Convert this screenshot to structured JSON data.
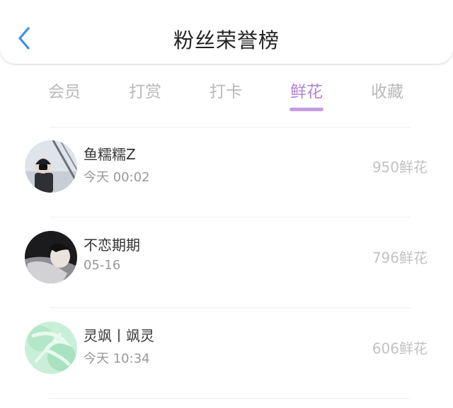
{
  "header": {
    "title": "粉丝荣誉榜",
    "back_icon": "chevron-left-icon"
  },
  "accent_color": "#b482d6",
  "tabs": [
    {
      "label": "会员",
      "active": false
    },
    {
      "label": "打赏",
      "active": false
    },
    {
      "label": "打卡",
      "active": false
    },
    {
      "label": "鲜花",
      "active": true
    },
    {
      "label": "收藏",
      "active": false
    }
  ],
  "ranking": [
    {
      "name": "鱼糯糯Z",
      "time": "今天 00:02",
      "amount": "950鲜花"
    },
    {
      "name": "不恋期期",
      "time": "05-16",
      "amount": "796鲜花"
    },
    {
      "name": "灵飒丨飒灵",
      "time": "今天 10:34",
      "amount": "606鲜花"
    }
  ]
}
